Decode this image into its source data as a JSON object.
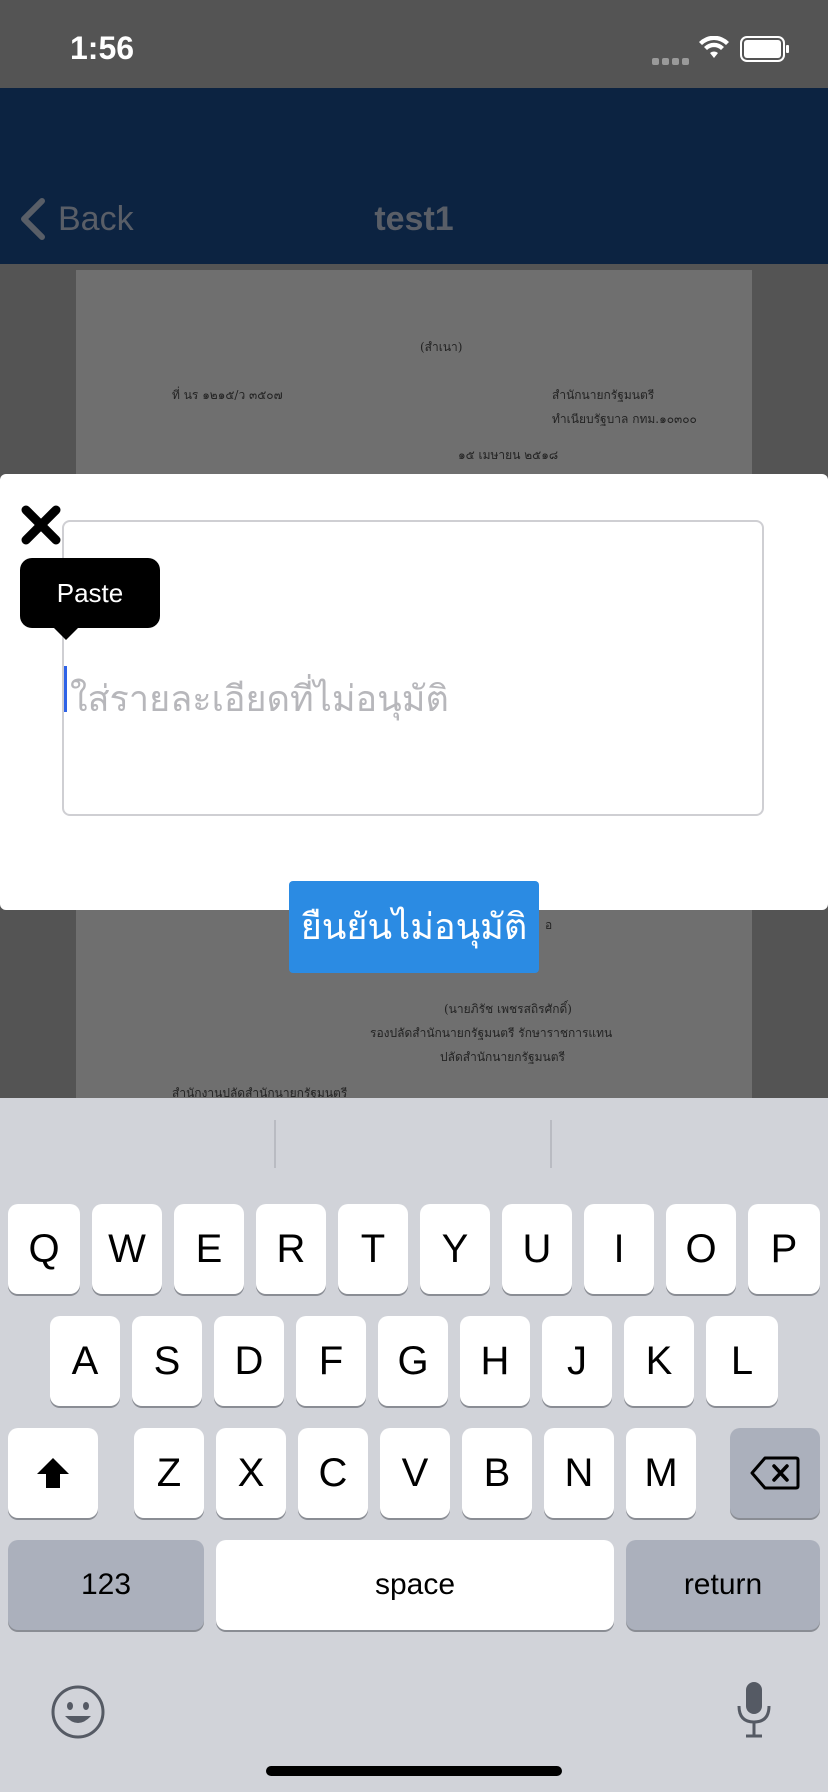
{
  "status": {
    "time": "1:56"
  },
  "nav": {
    "back_label": "Back",
    "title": "test1"
  },
  "document": {
    "lines": [
      "(สําเนา)",
      "ที่ นร ๑๒๑๕/ว ๓๕๐๗",
      "สํานักนายกรัฐมนตรี",
      "ทําเนียบรัฐบาล กทม.๑๐๓๐๐",
      "๑๕ เมษายน ๒๕๑๘",
      "อ",
      "(นายภิรัช เพชรสถิรศักดิ์)",
      "รองปลัดสํานักนายกรัฐมนตรี รักษาราชการแทน",
      "ปลัดสํานักนายกรัฐมนตรี",
      "สํานักงานปลัดสํานักนายกรัฐมนตรี"
    ]
  },
  "modal": {
    "placeholder": "ใส่รายละเอียดที่ไม่อนุมัติ",
    "paste_label": "Paste",
    "confirm_label": "ยืนยันไม่อนุมัติ"
  },
  "keyboard": {
    "row1": [
      "Q",
      "W",
      "E",
      "R",
      "T",
      "Y",
      "U",
      "I",
      "O",
      "P"
    ],
    "row2": [
      "A",
      "S",
      "D",
      "F",
      "G",
      "H",
      "J",
      "K",
      "L"
    ],
    "row3": [
      "Z",
      "X",
      "C",
      "V",
      "B",
      "N",
      "M"
    ],
    "numbers_label": "123",
    "space_label": "space",
    "return_label": "return"
  },
  "colors": {
    "nav_bg": "#0c2341",
    "confirm_bg": "#2b8be3",
    "caret": "#2f63e7"
  }
}
